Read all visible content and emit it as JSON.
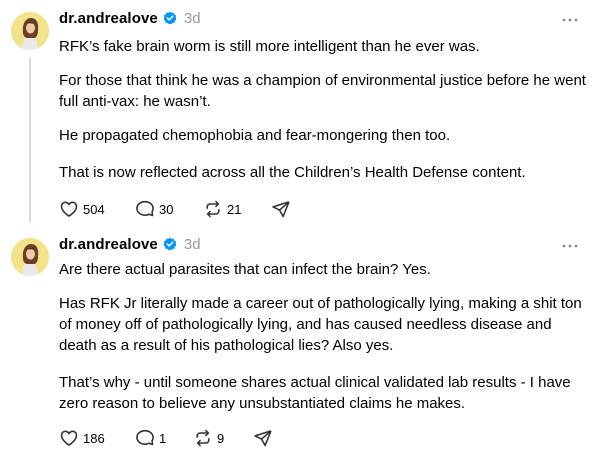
{
  "posts": [
    {
      "username": "dr.andrealove",
      "timestamp": "3d",
      "paragraphs": [
        "RFK’s fake brain worm is still more intelligent than he ever was.",
        "For those that think he was a champion of environmental justice before he went full anti-vax: he wasn’t.",
        "He propagated chemophobia and fear-mongering then too.",
        "That is now reflected across all the Children’s Health Defense content."
      ],
      "likes": "504",
      "replies": "30",
      "reposts": "21"
    },
    {
      "username": "dr.andrealove",
      "timestamp": "3d",
      "paragraphs": [
        "Are there actual parasites that can infect the brain? Yes.",
        "Has RFK Jr literally made a career out of pathologically lying, making a shit ton of money off of pathologically lying, and has caused needless disease and death as a result of his pathological lies? Also yes.",
        "That’s why - until someone shares actual clinical validated lab results - I have zero reason to believe any unsubstantiated claims he makes."
      ],
      "likes": "186",
      "replies": "1",
      "reposts": "9"
    }
  ],
  "icons": {
    "verified": "verified-badge-icon",
    "more": "more-horizontal-icon",
    "like": "heart-icon",
    "reply": "comment-bubble-icon",
    "repost": "repost-arrows-icon",
    "share": "send-paper-plane-icon"
  },
  "colors": {
    "verified_blue": "#0095f6",
    "timestamp_gray": "#999999",
    "thread_line": "#dadada",
    "avatar_bg": "#f2e28a"
  }
}
